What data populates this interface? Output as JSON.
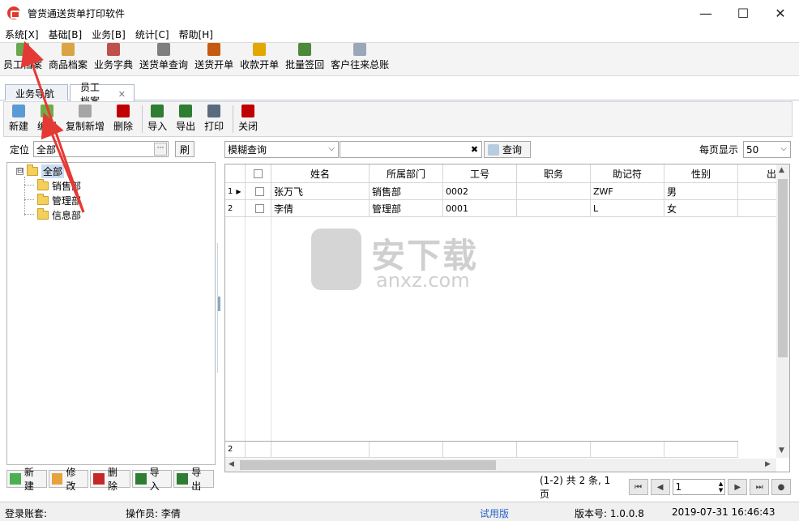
{
  "window": {
    "title": "管货通送货单打印软件",
    "controls": [
      "—",
      "☐",
      "✕"
    ]
  },
  "menu": [
    "系统[X]",
    "基础[B]",
    "业务[B]",
    "统计[C]",
    "帮助[H]"
  ],
  "toolbar": [
    {
      "label": "员工档案",
      "icon": "employee-icon",
      "color": "#6aa84f"
    },
    {
      "label": "商品档案",
      "icon": "product-icon",
      "color": "#d9a441"
    },
    {
      "label": "业务字典",
      "icon": "dictionary-icon",
      "color": "#c0504d"
    },
    {
      "label": "送货单查询",
      "icon": "delivery-query-icon",
      "color": "#7f7f7f"
    },
    {
      "label": "送货开单",
      "icon": "delivery-order-icon",
      "color": "#c55a11"
    },
    {
      "label": "收款开单",
      "icon": "payment-icon",
      "color": "#e0a800"
    },
    {
      "label": "批量签回",
      "icon": "batch-sign-icon",
      "color": "#4a8a3a"
    },
    {
      "label": "客户往来总账",
      "icon": "ledger-icon",
      "color": "#9aa7b8"
    }
  ],
  "tabs": [
    {
      "label": "业务导航",
      "active": false
    },
    {
      "label": "员工档案",
      "active": true,
      "close": "✕"
    }
  ],
  "doc_toolbar": [
    {
      "label": "新建",
      "icon": "new-icon",
      "color": "#5b9bd5"
    },
    {
      "label": "编辑",
      "icon": "edit-icon",
      "color": "#70ad47"
    },
    {
      "label": "复制新增",
      "icon": "copy-new-icon",
      "color": "#a5a5a5"
    },
    {
      "label": "删除",
      "icon": "delete-icon",
      "color": "#c00000"
    },
    {
      "label": "导入",
      "icon": "import-icon",
      "color": "#2e7d32"
    },
    {
      "label": "导出",
      "icon": "export-icon",
      "color": "#2e7d32"
    },
    {
      "label": "打印",
      "icon": "print-icon",
      "color": "#5a6b7d"
    },
    {
      "label": "关闭",
      "icon": "close-doc-icon",
      "color": "#c00000"
    }
  ],
  "left": {
    "locate_label": "定位",
    "locate_value": "全部",
    "locate_btn": "···",
    "refresh_btn": "刷",
    "tree": {
      "root": "全部",
      "expander": "⊟",
      "children": [
        "销售部",
        "管理部",
        "信息部"
      ]
    },
    "bottom_buttons": [
      {
        "label": "新建",
        "icon": "add-icon",
        "color": "#4caf50"
      },
      {
        "label": "修改",
        "icon": "modify-icon",
        "color": "#e6a23c"
      },
      {
        "label": "删除",
        "icon": "remove-icon",
        "color": "#c62828"
      },
      {
        "label": "导入",
        "icon": "import-small-icon",
        "color": "#2e7d32"
      },
      {
        "label": "导出",
        "icon": "export-small-icon",
        "color": "#2e7d32"
      }
    ]
  },
  "search": {
    "mode": "模糊查询",
    "query_value": "",
    "clear": "✖",
    "query_btn": "查询",
    "per_page_label": "每页显示",
    "per_page": "50"
  },
  "grid": {
    "columns": [
      "姓名",
      "所属部门",
      "工号",
      "职务",
      "助记符",
      "性别",
      "出"
    ],
    "rows": [
      {
        "num": "1",
        "name": "张万飞",
        "dept": "销售部",
        "no": "0002",
        "title": "",
        "mnemonic": "ZWF",
        "gender": "男"
      },
      {
        "num": "2",
        "name": "李倩",
        "dept": "管理部",
        "no": "0001",
        "title": "",
        "mnemonic": "L",
        "gender": "女"
      }
    ],
    "footer_count": "2"
  },
  "pager": {
    "summary": "(1-2) 共 2 条, 1 页",
    "page": "1"
  },
  "status": {
    "login": "登录账套:",
    "operator": "操作员: 李倩",
    "edition": "试用版",
    "version": "版本号: 1.0.0.8",
    "datetime": "2019-07-31  16:46:43"
  },
  "watermark": {
    "text": "安下载",
    "sub": "anxz.com"
  },
  "colors": {
    "accent_red": "#e53935",
    "edition_blue": "#2a62c9",
    "selection": "#ccdcf0"
  }
}
